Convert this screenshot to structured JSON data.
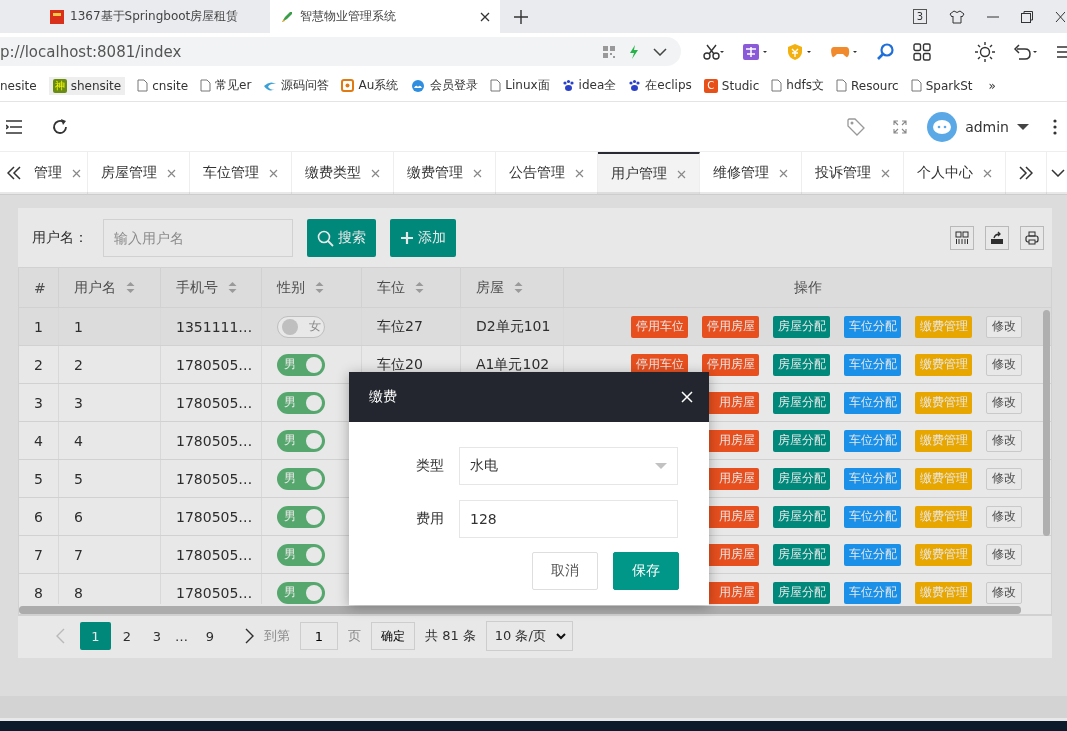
{
  "browser": {
    "tabs": [
      {
        "title": "1367基于Springboot房屋租赁",
        "selected": false
      },
      {
        "title": "智慧物业管理系统",
        "selected": true
      }
    ],
    "tab_count": "3",
    "url": "p://localhost:8081/index",
    "bookmarks": [
      {
        "label": "nesite"
      },
      {
        "label": "shensite",
        "badge": "神"
      },
      {
        "label": "cnsite"
      },
      {
        "label": "常见er"
      },
      {
        "label": "源码问答"
      },
      {
        "label": "Au系统"
      },
      {
        "label": "会员登录"
      },
      {
        "label": "Linux面"
      },
      {
        "label": "idea全"
      },
      {
        "label": "在eclips"
      },
      {
        "label": "Studic",
        "badge": "C"
      },
      {
        "label": "hdfs文"
      },
      {
        "label": "Resourc"
      },
      {
        "label": "SparkSt"
      }
    ],
    "bookmarks_more": "»"
  },
  "header": {
    "user": "admin"
  },
  "page_tabs": [
    {
      "label": "管理",
      "selected": false
    },
    {
      "label": "房屋管理",
      "selected": false
    },
    {
      "label": "车位管理",
      "selected": false
    },
    {
      "label": "缴费类型",
      "selected": false
    },
    {
      "label": "缴费管理",
      "selected": false
    },
    {
      "label": "公告管理",
      "selected": false
    },
    {
      "label": "用户管理",
      "selected": true
    },
    {
      "label": "维修管理",
      "selected": false
    },
    {
      "label": "投诉管理",
      "selected": false
    },
    {
      "label": "个人中心",
      "selected": false
    }
  ],
  "search": {
    "label": "用户名：",
    "placeholder": "输入用户名",
    "buttons": [
      {
        "label": "搜索"
      },
      {
        "label": "添加"
      }
    ]
  },
  "table": {
    "columns": [
      {
        "label": "#"
      },
      {
        "label": "用户名"
      },
      {
        "label": "手机号"
      },
      {
        "label": "性别"
      },
      {
        "label": "车位"
      },
      {
        "label": "房屋"
      },
      {
        "label": "操作"
      }
    ],
    "rows": [
      {
        "index": "1",
        "username": "1",
        "phone": "1351111…",
        "gender": "女",
        "gender_on": false,
        "parking": "车位27",
        "house": "D2单元101",
        "selected": true,
        "actions": [
          {
            "label": "停用车位",
            "kind": "danger"
          },
          {
            "label": "停用房屋",
            "kind": "danger"
          },
          {
            "label": "房屋分配",
            "kind": "primary"
          },
          {
            "label": "车位分配",
            "kind": "info"
          },
          {
            "label": "缴费管理",
            "kind": "warning"
          },
          {
            "label": "修改",
            "kind": "plain"
          }
        ]
      },
      {
        "index": "2",
        "username": "2",
        "phone": "1780505…",
        "gender": "男",
        "gender_on": true,
        "parking": "车位20",
        "house": "A1单元102",
        "selected": false,
        "actions": [
          {
            "label": "停用车位",
            "kind": "danger"
          },
          {
            "label": "停用房屋",
            "kind": "danger"
          },
          {
            "label": "房屋分配",
            "kind": "primary"
          },
          {
            "label": "车位分配",
            "kind": "info"
          },
          {
            "label": "缴费管理",
            "kind": "warning"
          },
          {
            "label": "修改",
            "kind": "plain"
          }
        ]
      },
      {
        "index": "3",
        "username": "3",
        "phone": "1780505…",
        "gender": "男",
        "gender_on": true,
        "selected": false,
        "actions": [
          {
            "label": "用房屋",
            "kind": "danger"
          },
          {
            "label": "房屋分配",
            "kind": "primary"
          },
          {
            "label": "车位分配",
            "kind": "info"
          },
          {
            "label": "缴费管理",
            "kind": "warning"
          },
          {
            "label": "修改",
            "kind": "plain"
          }
        ]
      },
      {
        "index": "4",
        "username": "4",
        "phone": "1780505…",
        "gender": "男",
        "gender_on": true,
        "selected": false,
        "actions": [
          {
            "label": "用房屋",
            "kind": "danger"
          },
          {
            "label": "房屋分配",
            "kind": "primary"
          },
          {
            "label": "车位分配",
            "kind": "info"
          },
          {
            "label": "缴费管理",
            "kind": "warning"
          },
          {
            "label": "修改",
            "kind": "plain"
          }
        ]
      },
      {
        "index": "5",
        "username": "5",
        "phone": "1780505…",
        "gender": "男",
        "gender_on": true,
        "selected": false,
        "actions": [
          {
            "label": "用房屋",
            "kind": "danger"
          },
          {
            "label": "房屋分配",
            "kind": "primary"
          },
          {
            "label": "车位分配",
            "kind": "info"
          },
          {
            "label": "缴费管理",
            "kind": "warning"
          },
          {
            "label": "修改",
            "kind": "plain"
          }
        ]
      },
      {
        "index": "6",
        "username": "6",
        "phone": "1780505…",
        "gender": "男",
        "gender_on": true,
        "selected": false,
        "actions": [
          {
            "label": "用房屋",
            "kind": "danger"
          },
          {
            "label": "房屋分配",
            "kind": "primary"
          },
          {
            "label": "车位分配",
            "kind": "info"
          },
          {
            "label": "缴费管理",
            "kind": "warning"
          },
          {
            "label": "修改",
            "kind": "plain"
          }
        ]
      },
      {
        "index": "7",
        "username": "7",
        "phone": "1780505…",
        "gender": "男",
        "gender_on": true,
        "selected": false,
        "actions": [
          {
            "label": "用房屋",
            "kind": "danger"
          },
          {
            "label": "房屋分配",
            "kind": "primary"
          },
          {
            "label": "车位分配",
            "kind": "info"
          },
          {
            "label": "缴费管理",
            "kind": "warning"
          },
          {
            "label": "修改",
            "kind": "plain"
          }
        ]
      },
      {
        "index": "8",
        "username": "8",
        "phone": "1780505…",
        "gender": "男",
        "gender_on": true,
        "selected": false,
        "actions": [
          {
            "label": "用房屋",
            "kind": "danger"
          },
          {
            "label": "房屋分配",
            "kind": "primary"
          },
          {
            "label": "车位分配",
            "kind": "info"
          },
          {
            "label": "缴费管理",
            "kind": "warning"
          },
          {
            "label": "修改",
            "kind": "plain"
          }
        ]
      }
    ]
  },
  "pagination": {
    "prev_disabled": true,
    "pages": [
      {
        "label": "1",
        "selected": true
      },
      {
        "label": "2",
        "selected": false
      },
      {
        "label": "3",
        "selected": false
      }
    ],
    "ellipsis": "…",
    "last": {
      "label": "9",
      "selected": false
    },
    "goto_label": "到第",
    "goto_value": "1",
    "page_unit": "页",
    "confirm": "确定",
    "total": "共 81 条",
    "page_size": "10 条/页"
  },
  "dialog": {
    "title": "缴费",
    "fields": [
      {
        "label": "类型",
        "kind": "select",
        "value": "水电"
      },
      {
        "label": "费用",
        "kind": "input",
        "value": "128"
      }
    ],
    "buttons": [
      {
        "label": "取消",
        "kind": "plain"
      },
      {
        "label": "保存",
        "kind": "primary"
      }
    ]
  }
}
